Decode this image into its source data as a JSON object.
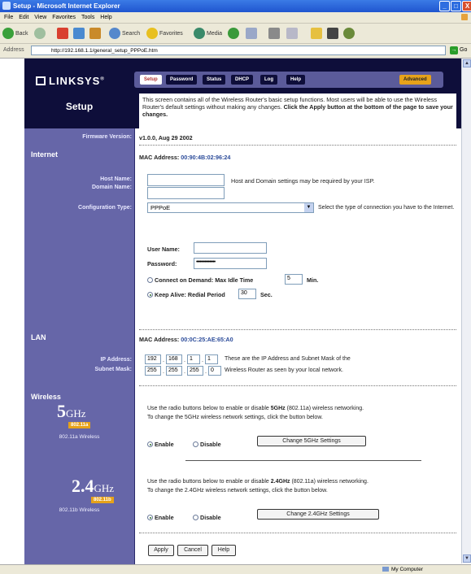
{
  "window": {
    "title": "Setup - Microsoft Internet Explorer",
    "min": "_",
    "max": "□",
    "close": "X"
  },
  "menu": [
    "File",
    "Edit",
    "View",
    "Favorites",
    "Tools",
    "Help"
  ],
  "toolbar": {
    "back": "Back",
    "search": "Search",
    "favorites": "Favorites",
    "media": "Media"
  },
  "address": {
    "label": "Address",
    "url": "http://192.168.1.1/general_setup_PPPoE.htm",
    "go": "Go"
  },
  "status": {
    "zone": "My Computer"
  },
  "brand": {
    "logo": "LINKSYS",
    "trademark": "®"
  },
  "tabs": [
    {
      "label": "Setup",
      "active": true
    },
    {
      "label": "Password",
      "active": false
    },
    {
      "label": "Status",
      "active": false
    },
    {
      "label": "DHCP",
      "active": false
    },
    {
      "label": "Log",
      "active": false
    },
    {
      "label": "Help",
      "active": false
    }
  ],
  "advanced_tab": "Advanced",
  "page_title": "Setup",
  "intro": {
    "text": "This screen contains all of the Wireless Router's basic setup functions. Most users will be able to use the Wireless Router's default settings without making any changes.",
    "bold": "Click the Apply button at the bottom of the page to save your changes."
  },
  "firmware": {
    "label": "Firmware Version:",
    "value": "v1.0.0, Aug 29 2002"
  },
  "internet": {
    "section": "Internet",
    "mac_label": "MAC Address:",
    "mac_value": "00:90:4B:02:96:24",
    "host_label": "Host Name:",
    "domain_label": "Domain Name:",
    "host_note": "Host and Domain settings may be required by your ISP.",
    "config_label": "Configuration Type:",
    "config_value": "PPPoE",
    "config_note": "Select the type of connection you have to the Internet.",
    "user_label": "User Name:",
    "pass_label": "Password:",
    "pass_value": "••••••••••••••••",
    "cod_label": "Connect on Demand: Max Idle Time",
    "cod_value": "5",
    "cod_unit": "Min.",
    "keep_label": "Keep Alive: Redial Period",
    "keep_value": "30",
    "keep_unit": "Sec."
  },
  "lan": {
    "section": "LAN",
    "mac_label": "MAC Address:",
    "mac_value": "00:0C:25:AE:65:A0",
    "ip_label": "IP Address:",
    "mask_label": "Subnet Mask:",
    "ip": [
      "192",
      "168",
      "1",
      "1"
    ],
    "mask": [
      "255",
      "255",
      "255",
      "0"
    ],
    "note1": "These are the IP Address and Subnet Mask of the",
    "note2": "Wireless Router as seen by your local network."
  },
  "wireless": {
    "section": "Wireless",
    "g5": {
      "big": "5",
      "unit": "GHz",
      "badge": "802.11a",
      "sub": "802.11a Wireless",
      "line1_pre": "Use the radio buttons below to enable or disable",
      "line1_bold": "5GHz",
      "line1_post": "(802.11a) wireless networking.",
      "line2": "To change the 5GHz wireless network settings, click the button below.",
      "enable": "Enable",
      "disable": "Disable",
      "button": "Change 5GHz Settings"
    },
    "g24": {
      "big": "2.4",
      "unit": "GHz",
      "badge": "802.11b",
      "sub": "802.11b Wireless",
      "line1_pre": "Use the radio buttons below to enable or disable",
      "line1_bold": "2.4GHz",
      "line1_post": "(802.11a) wireless networking.",
      "line2": "To change the 2.4GHz wireless network settings, click the button below.",
      "enable": "Enable",
      "disable": "Disable",
      "button": "Change 2.4GHz Settings"
    }
  },
  "actions": {
    "apply": "Apply",
    "cancel": "Cancel",
    "help": "Help"
  }
}
